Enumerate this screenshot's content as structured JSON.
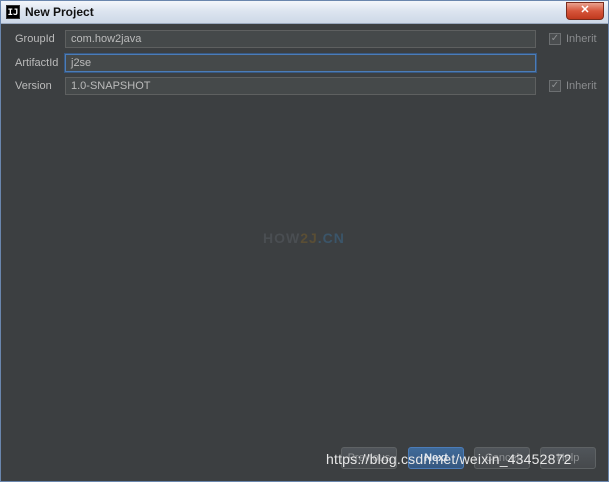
{
  "window": {
    "title": "New Project",
    "app_icon_text": "IJ",
    "close_label": "✕"
  },
  "form": {
    "group_id": {
      "label": "GroupId",
      "value": "com.how2java",
      "inherit_label": "Inherit",
      "inherit_checked": true
    },
    "artifact_id": {
      "label": "ArtifactId",
      "value": "j2se"
    },
    "version": {
      "label": "Version",
      "value": "1.0-SNAPSHOT",
      "inherit_label": "Inherit",
      "inherit_checked": true
    }
  },
  "watermark": {
    "part1": "HOW",
    "part2": "2J",
    "part3": ".CN"
  },
  "buttons": {
    "previous": "Previous",
    "next": "Next",
    "cancel": "Cancel",
    "help": "Help"
  },
  "credit_text": "https://blog.csdn.net/weixin_43452872",
  "colors": {
    "background": "#3c3f41",
    "field_background": "#45494a",
    "focus_border": "#4b7cb8",
    "text": "#bbbbbb"
  }
}
